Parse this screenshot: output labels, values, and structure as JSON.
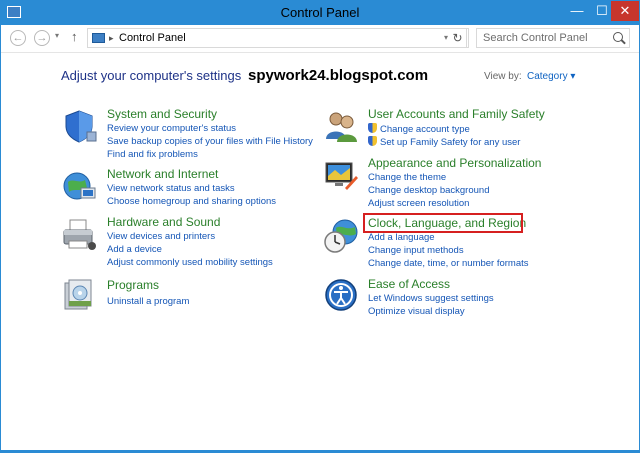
{
  "window": {
    "title": "Control Panel",
    "controls": {
      "minimize": "—",
      "maximize": "☐",
      "close": "✕"
    }
  },
  "nav": {
    "back_glyph": "←",
    "forward_glyph": "→",
    "recent_glyph": "▾",
    "up_glyph": "↑",
    "address_separator": "▸",
    "address_path": "Control Panel",
    "address_dropdown_glyph": "▾",
    "refresh_glyph": "↻",
    "search_placeholder": "Search Control Panel"
  },
  "content": {
    "heading": "Adjust your computer's settings",
    "watermark": "spywork24.blogspot.com",
    "view_by_label": "View by:",
    "view_by_value": "Category ▾",
    "categories": [
      {
        "title": "System and Security",
        "icon": "shield-icon",
        "links": [
          "Review your computer's status",
          "Save backup copies of your files with File History",
          "Find and fix problems"
        ]
      },
      {
        "title": "Network and Internet",
        "icon": "network-globe-icon",
        "links": [
          "View network status and tasks",
          "Choose homegroup and sharing options"
        ]
      },
      {
        "title": "Hardware and Sound",
        "icon": "printer-icon",
        "links": [
          "View devices and printers",
          "Add a device",
          "Adjust commonly used mobility settings"
        ]
      },
      {
        "title": "Programs",
        "icon": "programs-icon",
        "links": [
          "Uninstall a program"
        ]
      },
      {
        "title": "User Accounts and Family Safety",
        "icon": "users-icon",
        "links": [
          "Change account type",
          "Set up Family Safety for any user"
        ]
      },
      {
        "title": "Appearance and Personalization",
        "icon": "monitor-paint-icon",
        "links": [
          "Change the theme",
          "Change desktop background",
          "Adjust screen resolution"
        ]
      },
      {
        "title": "Clock, Language, and Region",
        "icon": "clock-globe-icon",
        "links": [
          "Add a language",
          "Change input methods",
          "Change date, time, or number formats"
        ]
      },
      {
        "title": "Ease of Access",
        "icon": "ease-of-access-icon",
        "links": [
          "Let Windows suggest settings",
          "Optimize visual display"
        ]
      }
    ]
  },
  "colors": {
    "frame": "#2a8bd4",
    "heading": "#1e3287",
    "category_title": "#2a7f2a",
    "link": "#1556b6",
    "highlight": "#d62020",
    "close_button": "#c7362c"
  }
}
